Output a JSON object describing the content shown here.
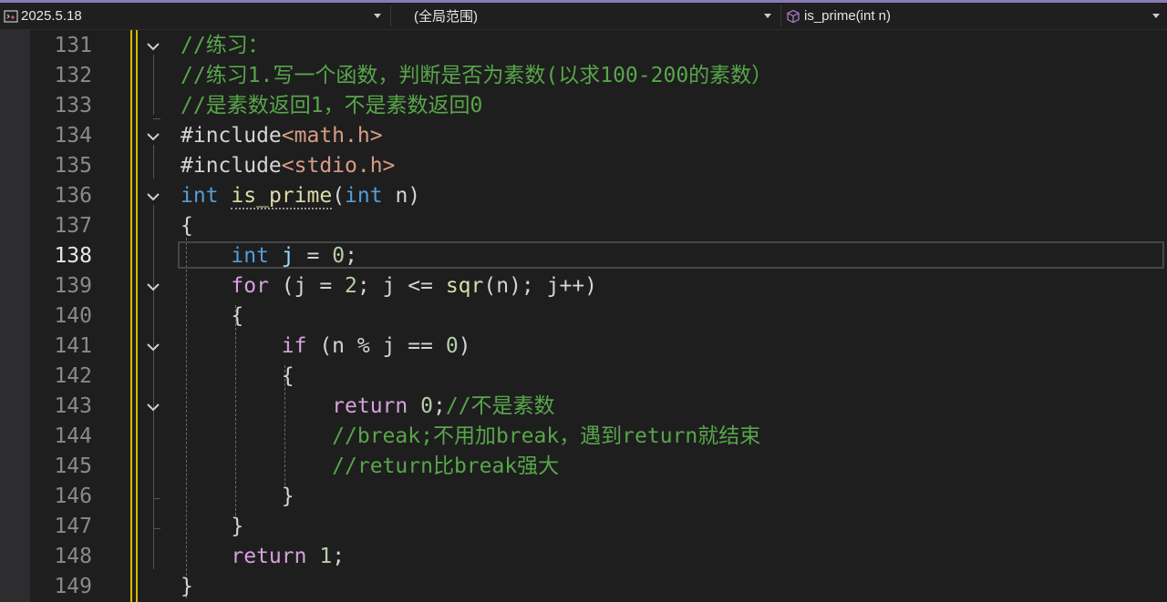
{
  "navbar": {
    "project": "2025.5.18",
    "scope": "(全局范围)",
    "member": "is_prime(int n)"
  },
  "colors": {
    "keyword": "#569cd6",
    "control": "#d8a0df",
    "comment": "#57a64a",
    "function": "#dcdcaa",
    "include_path": "#d69d85",
    "change_indicator": "#d7ba00"
  },
  "editor": {
    "active_line": 138,
    "lines": [
      {
        "no": "131",
        "fold": true,
        "tokens": [
          {
            "t": "//练习：",
            "c": "cm"
          }
        ]
      },
      {
        "no": "132",
        "fold": false,
        "tokens": [
          {
            "t": "//练习1.写一个函数，判断是否为素数(以求100-200的素数）",
            "c": "cm"
          }
        ]
      },
      {
        "no": "133",
        "fold": false,
        "tokens": [
          {
            "t": "//是素数返回1，不是素数返回0",
            "c": "cm"
          }
        ]
      },
      {
        "no": "134",
        "fold": true,
        "tokens": [
          {
            "t": "#include",
            "c": "txt"
          },
          {
            "t": "<math.h>",
            "c": "str"
          }
        ]
      },
      {
        "no": "135",
        "fold": false,
        "tokens": [
          {
            "t": "#include",
            "c": "txt"
          },
          {
            "t": "<stdio.h>",
            "c": "str"
          }
        ]
      },
      {
        "no": "136",
        "fold": true,
        "tokens": [
          {
            "t": "int",
            "c": "kw"
          },
          {
            "t": " ",
            "c": "txt"
          },
          {
            "t": "is_prime",
            "c": "fn",
            "u": true
          },
          {
            "t": "(",
            "c": "txt"
          },
          {
            "t": "int",
            "c": "kw"
          },
          {
            "t": " n)",
            "c": "txt"
          }
        ]
      },
      {
        "no": "137",
        "fold": false,
        "tokens": [
          {
            "t": "{",
            "c": "txt"
          }
        ]
      },
      {
        "no": "138",
        "fold": false,
        "tokens": [
          {
            "t": "    ",
            "c": "txt"
          },
          {
            "t": "int",
            "c": "kw"
          },
          {
            "t": " ",
            "c": "txt"
          },
          {
            "t": "j",
            "c": "var"
          },
          {
            "t": " = ",
            "c": "txt"
          },
          {
            "t": "0",
            "c": "num"
          },
          {
            "t": ";",
            "c": "txt"
          }
        ]
      },
      {
        "no": "139",
        "fold": true,
        "tokens": [
          {
            "t": "    ",
            "c": "txt"
          },
          {
            "t": "for",
            "c": "ctl"
          },
          {
            "t": " (j = ",
            "c": "txt"
          },
          {
            "t": "2",
            "c": "num"
          },
          {
            "t": "; j <= ",
            "c": "txt"
          },
          {
            "t": "sqr",
            "c": "fn"
          },
          {
            "t": "(n); j++)",
            "c": "txt"
          }
        ]
      },
      {
        "no": "140",
        "fold": false,
        "tokens": [
          {
            "t": "    {",
            "c": "txt"
          }
        ]
      },
      {
        "no": "141",
        "fold": true,
        "tokens": [
          {
            "t": "        ",
            "c": "txt"
          },
          {
            "t": "if",
            "c": "ctl"
          },
          {
            "t": " (n % j == ",
            "c": "txt"
          },
          {
            "t": "0",
            "c": "num"
          },
          {
            "t": ")",
            "c": "txt"
          }
        ]
      },
      {
        "no": "142",
        "fold": false,
        "tokens": [
          {
            "t": "        {",
            "c": "txt"
          }
        ]
      },
      {
        "no": "143",
        "fold": true,
        "tokens": [
          {
            "t": "            ",
            "c": "txt"
          },
          {
            "t": "return",
            "c": "ctl"
          },
          {
            "t": " ",
            "c": "txt"
          },
          {
            "t": "0",
            "c": "num"
          },
          {
            "t": ";",
            "c": "txt"
          },
          {
            "t": "//不是素数",
            "c": "cm"
          }
        ]
      },
      {
        "no": "144",
        "fold": false,
        "tokens": [
          {
            "t": "            ",
            "c": "txt"
          },
          {
            "t": "//break;不用加break，遇到return就结束",
            "c": "cm"
          }
        ]
      },
      {
        "no": "145",
        "fold": false,
        "tokens": [
          {
            "t": "            ",
            "c": "txt"
          },
          {
            "t": "//return比break强大",
            "c": "cm"
          }
        ]
      },
      {
        "no": "146",
        "fold": false,
        "tokens": [
          {
            "t": "        }",
            "c": "txt"
          }
        ]
      },
      {
        "no": "147",
        "fold": false,
        "tokens": [
          {
            "t": "    }",
            "c": "txt"
          }
        ]
      },
      {
        "no": "148",
        "fold": false,
        "tokens": [
          {
            "t": "    ",
            "c": "txt"
          },
          {
            "t": "return",
            "c": "ctl"
          },
          {
            "t": " ",
            "c": "txt"
          },
          {
            "t": "1",
            "c": "num"
          },
          {
            "t": ";",
            "c": "txt"
          }
        ]
      },
      {
        "no": "149",
        "fold": false,
        "tokens": [
          {
            "t": "}",
            "c": "txt"
          }
        ]
      }
    ]
  }
}
